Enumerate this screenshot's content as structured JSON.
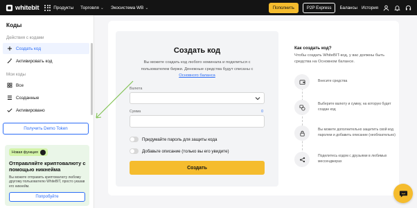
{
  "brand": {
    "name": "whitebit",
    "accent": "#f5bc2e",
    "link_color": "#2b6cf6"
  },
  "topnav": {
    "items": [
      {
        "label": "Продукты"
      },
      {
        "label": "Торговля"
      },
      {
        "label": "Экосистема WB"
      }
    ],
    "deposit_label": "Пополнить",
    "p2p_label": "P2P Express",
    "balances_label": "Балансы",
    "history_label": "История"
  },
  "sidebar": {
    "title": "Коды",
    "section_actions": "Действия с кодами",
    "actions": [
      {
        "label": "Создать код",
        "icon": "plus-icon",
        "active": true
      },
      {
        "label": "Активировать код",
        "icon": "wand-icon",
        "active": false
      }
    ],
    "section_my": "Мои коды",
    "my_codes": [
      {
        "label": "Все",
        "icon": "grid-icon"
      },
      {
        "label": "Созданные",
        "icon": "list-icon"
      },
      {
        "label": "Активировано",
        "icon": "check-icon"
      }
    ],
    "demo_token_label": "Получить Demo Token",
    "promo": {
      "badge": "Новая функция",
      "title": "Отправляйте криптовалюту с помощью никнейма",
      "description": "Вы можете отправить криптовалюту любому другому пользователю WhiteBIT, просто указав его никнейм.",
      "button": "Попробуйте"
    }
  },
  "form": {
    "title": "Создать код",
    "description": "Вы можете создать код любого номинала и поделиться с пользователем биржи. Денежные средства будут списаны с",
    "description_link": "Основного баланса",
    "currency_label": "Валюта",
    "amount_label": "Сумма",
    "amount_max": "0",
    "password_toggle": "Придумайте пароль для защиты кода",
    "description_toggle": "Добавьте описание (только вы его увидите)",
    "submit": "Создать"
  },
  "help": {
    "title": "Как создать код?",
    "description": "Чтобы создать WhiteBIT-код, у вас должны быть средства на Основном балансе.",
    "steps": [
      {
        "icon": "wallet-icon",
        "text": "Внесите средства"
      },
      {
        "icon": "coins-icon",
        "text": "Выберите валюту и сумму, на которую будет создан код"
      },
      {
        "icon": "lock-icon",
        "text": "Вы можете дополнительно защитить свой код паролем и добавить описание (необязательно)"
      },
      {
        "icon": "share-icon",
        "text": "Поделитесь кодом с друзьями в любимых мессенджерах"
      }
    ]
  }
}
